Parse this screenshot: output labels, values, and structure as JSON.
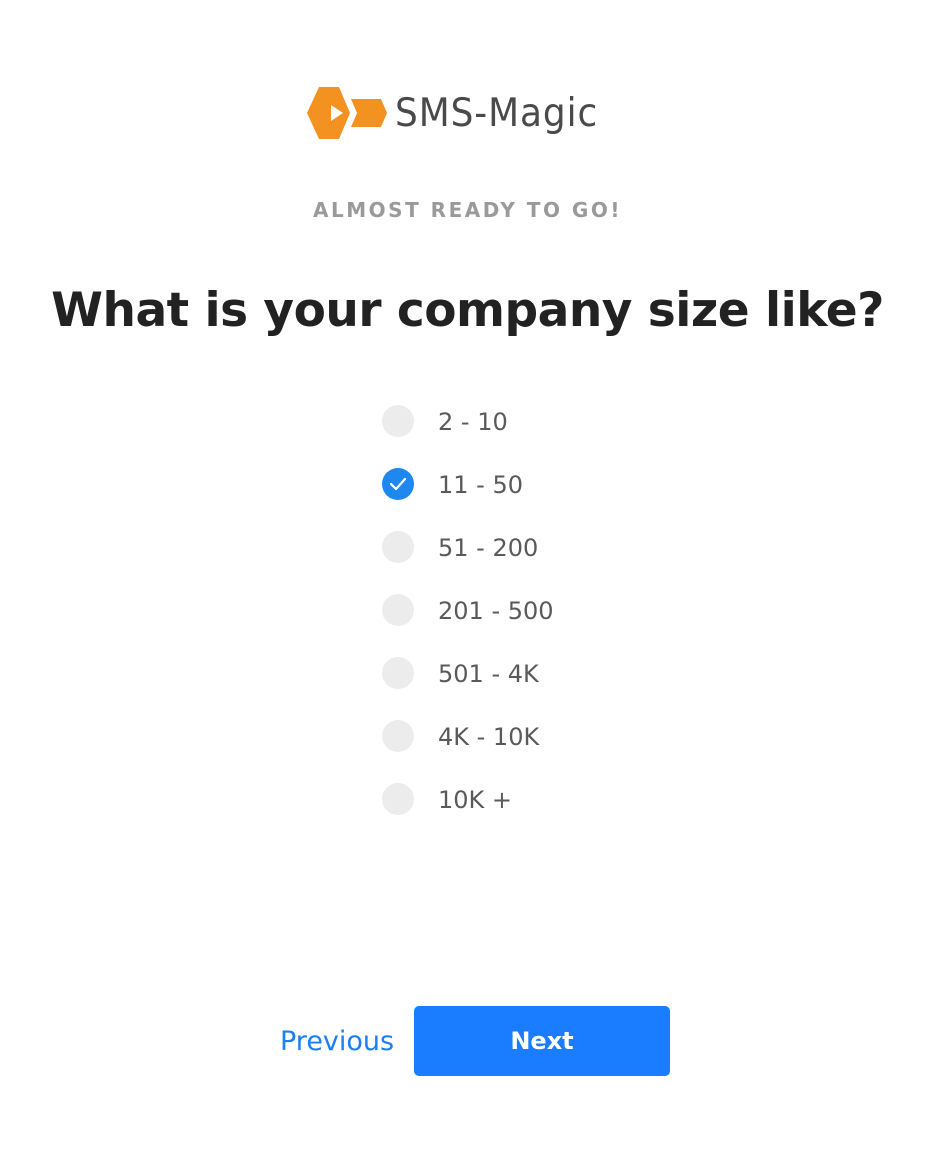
{
  "brand": {
    "name": "SMS-Magic",
    "logo_color": "#f49221"
  },
  "eyebrow": "ALMOST READY TO GO!",
  "question": "What is your company size like?",
  "options": [
    {
      "label": "2 - 10",
      "checked": false
    },
    {
      "label": "11 - 50",
      "checked": true
    },
    {
      "label": "51 - 200",
      "checked": false
    },
    {
      "label": "201 - 500",
      "checked": false
    },
    {
      "label": "501 - 4K",
      "checked": false
    },
    {
      "label": "4K - 10K",
      "checked": false
    },
    {
      "label": "10K +",
      "checked": false
    }
  ],
  "nav": {
    "previous_label": "Previous",
    "next_label": "Next"
  },
  "colors": {
    "accent": "#1a7cff",
    "radio_checked": "#1e88f0",
    "radio_unchecked": "#ececec",
    "heading": "#222222",
    "muted": "#9a9a9a"
  },
  "icons": {
    "logo": "sms-magic-logo-icon",
    "check": "check-icon"
  }
}
